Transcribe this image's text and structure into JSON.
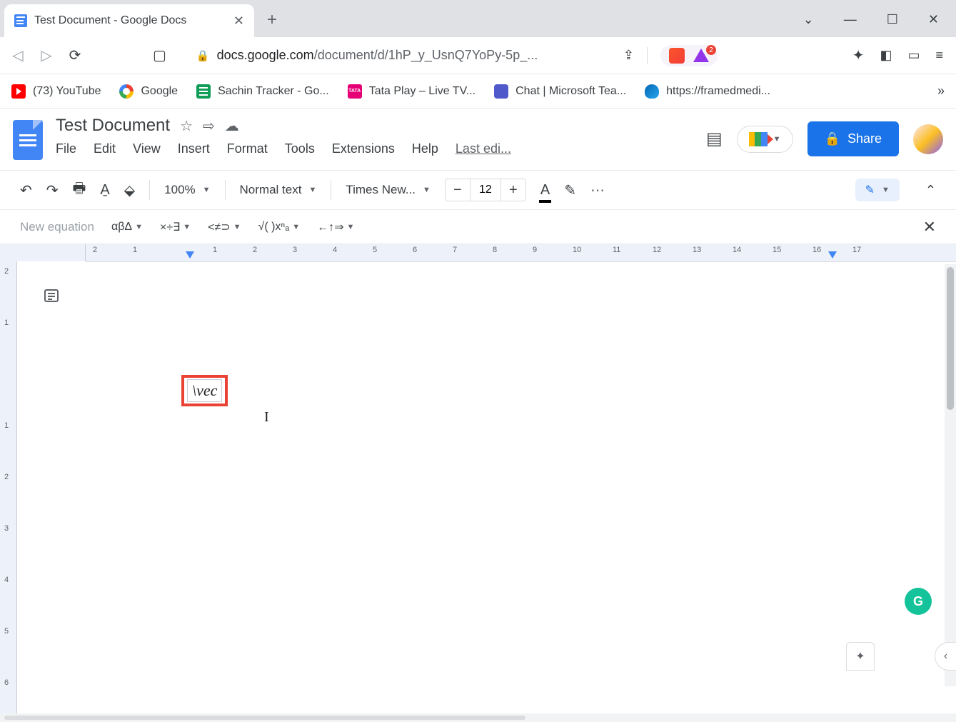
{
  "browser": {
    "tab_title": "Test Document - Google Docs",
    "url_host": "docs.google.com",
    "url_path": "/document/d/1hP_y_UsnQ7YoPy-5p_...",
    "ext_badge": "2"
  },
  "bookmarks": [
    {
      "label": "(73) YouTube"
    },
    {
      "label": "Google"
    },
    {
      "label": "Sachin Tracker - Go..."
    },
    {
      "label": "Tata Play – Live TV..."
    },
    {
      "label": "Chat | Microsoft Tea..."
    },
    {
      "label": "https://framedmedi..."
    }
  ],
  "doc": {
    "title": "Test Document",
    "menus": [
      "File",
      "Edit",
      "View",
      "Insert",
      "Format",
      "Tools",
      "Extensions",
      "Help"
    ],
    "last_edit": "Last edi...",
    "share_label": "Share"
  },
  "toolbar": {
    "zoom": "100%",
    "style": "Normal text",
    "font": "Times New...",
    "font_size": "12"
  },
  "equation_toolbar": {
    "label": "New equation",
    "groups": [
      "αβΔ",
      "×÷∃",
      "<≠⊃",
      "√( )xⁿₐ",
      "←↑⇒"
    ]
  },
  "ruler": {
    "h_marks": [
      "2",
      "1",
      "",
      "1",
      "2",
      "3",
      "4",
      "5",
      "6",
      "7",
      "8",
      "9",
      "10",
      "11",
      "12",
      "13",
      "14",
      "15",
      "16",
      "17"
    ],
    "v_marks": [
      "2",
      "1",
      "",
      "1",
      "2",
      "3",
      "4",
      "5",
      "6"
    ]
  },
  "equation_text": "\\vec",
  "cursor_char": "I",
  "grammarly_label": "G"
}
